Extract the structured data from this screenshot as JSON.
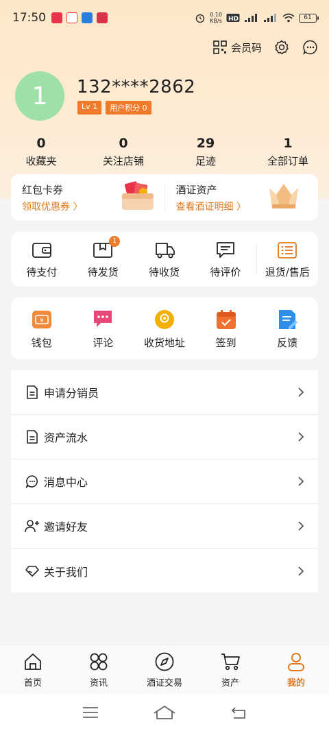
{
  "status_bar": {
    "time": "17:50",
    "net_speed_value": "0.10",
    "net_speed_unit": "KB/s",
    "battery": "61"
  },
  "top": {
    "member_code_label": "会员码"
  },
  "profile": {
    "avatar_text": "1",
    "phone": "132****2862",
    "level_badge": "Lv 1",
    "points_badge": "用户积分 0"
  },
  "stats": [
    {
      "value": "0",
      "label": "收藏夹"
    },
    {
      "value": "0",
      "label": "关注店铺"
    },
    {
      "value": "29",
      "label": "足迹"
    },
    {
      "value": "1",
      "label": "全部订单"
    }
  ],
  "assets": {
    "coupons": {
      "title": "红包卡券",
      "subtitle": "领取优惠券 〉"
    },
    "wine_cert": {
      "title": "酒证资产",
      "subtitle": "查看酒证明细 〉"
    }
  },
  "orders": [
    {
      "label": "待支付",
      "icon": "wallet-icon"
    },
    {
      "label": "待发货",
      "icon": "package-icon",
      "badge": "1"
    },
    {
      "label": "待收货",
      "icon": "truck-icon"
    },
    {
      "label": "待评价",
      "icon": "comment-icon"
    },
    {
      "label": "退货/售后",
      "icon": "return-list-icon"
    }
  ],
  "tools": [
    {
      "label": "钱包",
      "icon": "wallet-icon",
      "color": "#f08a3c"
    },
    {
      "label": "评论",
      "icon": "chat-icon",
      "color": "#e8477a"
    },
    {
      "label": "收货地址",
      "icon": "location-pin-icon",
      "color": "#f4b000"
    },
    {
      "label": "签到",
      "icon": "calendar-check-icon",
      "color": "#f07030"
    },
    {
      "label": "反馈",
      "icon": "feedback-icon",
      "color": "#2f8ee8"
    }
  ],
  "menu": [
    {
      "label": "申请分销员",
      "icon": "document-icon"
    },
    {
      "label": "资产流水",
      "icon": "document-icon"
    },
    {
      "label": "消息中心",
      "icon": "message-icon"
    },
    {
      "label": "邀请好友",
      "icon": "add-user-icon"
    },
    {
      "label": "关于我们",
      "icon": "diamond-icon"
    }
  ],
  "tabbar": [
    {
      "label": "首页",
      "icon": "home-icon"
    },
    {
      "label": "资讯",
      "icon": "grid-clover-icon"
    },
    {
      "label": "酒证交易",
      "icon": "compass-icon"
    },
    {
      "label": "资产",
      "icon": "cart-icon"
    },
    {
      "label": "我的",
      "icon": "user-icon",
      "active": true
    }
  ],
  "colors": {
    "accent": "#e07a20",
    "badge": "#ee7a2a",
    "header_gradient_top": "#fde7c9",
    "avatar": "#9ee0a8"
  }
}
